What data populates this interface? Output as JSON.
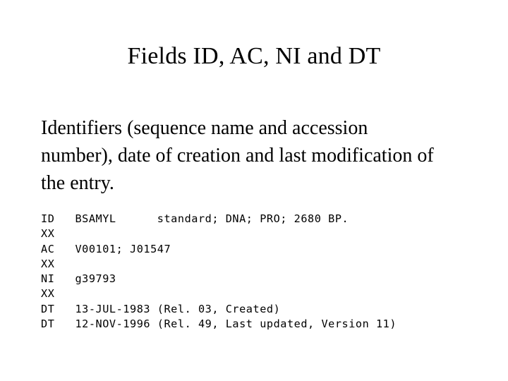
{
  "slide": {
    "title": "Fields ID, AC, NI and DT",
    "paragraph": "Identifiers (sequence name and accession number), date of creation and last modification of the entry.",
    "text_color": "#000000",
    "background_color": "#ffffff",
    "record": {
      "lines": [
        "ID   BSAMYL      standard; DNA; PRO; 2680 BP.",
        "XX",
        "AC   V00101; J01547",
        "XX",
        "NI   g39793",
        "XX",
        "DT   13-JUL-1983 (Rel. 03, Created)",
        "DT   12-NOV-1996 (Rel. 49, Last updated, Version 11)"
      ],
      "fields": [
        {
          "code": "ID",
          "value": "BSAMYL      standard; DNA; PRO; 2680 BP."
        },
        {
          "code": "XX",
          "value": ""
        },
        {
          "code": "AC",
          "value": "V00101; J01547"
        },
        {
          "code": "XX",
          "value": ""
        },
        {
          "code": "NI",
          "value": "g39793"
        },
        {
          "code": "XX",
          "value": ""
        },
        {
          "code": "DT",
          "value": "13-JUL-1983 (Rel. 03, Created)"
        },
        {
          "code": "DT",
          "value": "12-NOV-1996 (Rel. 49, Last updated, Version 11)"
        }
      ]
    }
  }
}
